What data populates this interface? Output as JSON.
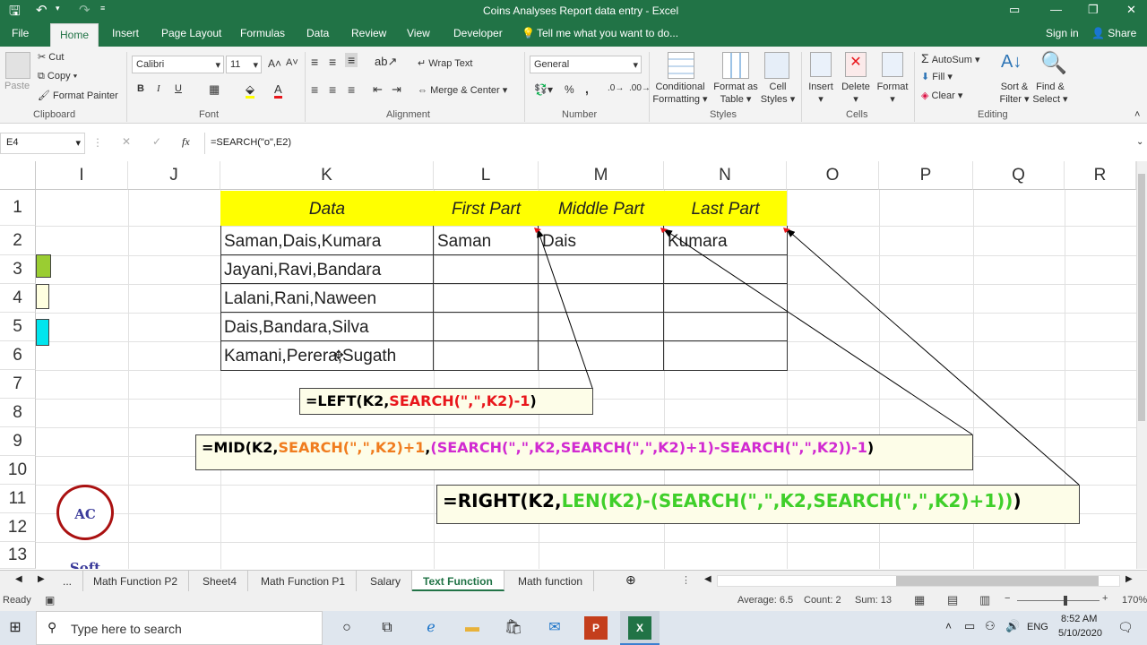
{
  "titlebar": {
    "title": "Coins Analyses Report data entry  -  Excel",
    "min": "—",
    "restore": "❐",
    "close": "✕",
    "opts": "▭"
  },
  "tabs": {
    "file": "File",
    "home": "Home",
    "insert": "Insert",
    "page_layout": "Page Layout",
    "formulas": "Formulas",
    "data": "Data",
    "review": "Review",
    "view": "View",
    "developer": "Developer",
    "tell": "Tell me what you want to do...",
    "signin": "Sign in",
    "share": "Share"
  },
  "ribbon": {
    "paste": "Paste",
    "cut": "Cut",
    "copy": "Copy",
    "format_painter": "Format Painter",
    "clipboard": "Clipboard",
    "font_name": "Calibri",
    "font_size": "11",
    "bold": "B",
    "italic": "I",
    "underline": "U",
    "font": "Font",
    "wrap_text": "Wrap Text",
    "merge_center": "Merge & Center",
    "alignment": "Alignment",
    "number_format": "General",
    "number": "Number",
    "percent": "%",
    "comma": ",",
    "conditional": "Conditional",
    "formatting": "Formatting",
    "format_as": "Format as",
    "table": "Table",
    "cell": "Cell",
    "cell_styles": "Styles",
    "styles": "Styles",
    "insert": "Insert",
    "delete": "Delete",
    "format": "Format",
    "cells": "Cells",
    "autosum": "AutoSum",
    "fill": "Fill",
    "clear": "Clear",
    "sort_filter": "Sort &",
    "filter": "Filter",
    "find_select": "Find &",
    "select": "Select",
    "editing": "Editing"
  },
  "formula_bar": {
    "name_box": "E4",
    "fx": "fx",
    "formula": "=SEARCH(\"o\",E2)"
  },
  "columns": [
    "I",
    "J",
    "K",
    "L",
    "M",
    "N",
    "O",
    "P",
    "Q",
    "R"
  ],
  "rows": [
    "1",
    "2",
    "3",
    "4",
    "5",
    "6",
    "7",
    "8",
    "9",
    "10",
    "11",
    "12",
    "13"
  ],
  "table": {
    "headers": [
      "Data",
      "First Part",
      "Middle Part",
      "Last Part"
    ],
    "data": [
      "Saman,Dais,Kumara",
      "Jayani,Ravi,Bandara",
      "Lalani,Rani,Naween",
      "Dais,Bandara,Silva",
      "Kamani,Perera,Sugath"
    ],
    "first": "Saman",
    "middle": "Dais",
    "last": "Kumara"
  },
  "formulas": {
    "left": {
      "a": "=LEFT(K2,",
      "b": "SEARCH(\",\",K2)-1",
      "c": ")"
    },
    "mid": {
      "a": "=MID(K2,",
      "b": "SEARCH(\",\",K2)+1",
      "c": ",",
      "d": "(SEARCH(\",\",K2,SEARCH(\",\",K2)+1)-SEARCH(\",\",K2))-1",
      "e": ")"
    },
    "right": {
      "a": "=RIGHT(K2,",
      "b": "LEN(K2)-(SEARCH(\",\",K2,SEARCH(\",\",K2)+1))",
      "c": ")"
    }
  },
  "logo": {
    "text": "AC Soft"
  },
  "sheets": [
    "...",
    "Math Function P2",
    "Sheet4",
    "Math Function P1",
    "Salary",
    "Text Function",
    "Math function"
  ],
  "status": {
    "ready": "Ready",
    "average": "Average: 6.5",
    "count": "Count: 2",
    "sum": "Sum: 13",
    "zoom": "170%"
  },
  "taskbar": {
    "search": "Type here to search",
    "lang": "ENG",
    "time": "8:52 AM",
    "date": "5/10/2020"
  },
  "colors": {
    "excel_green": "#217346",
    "header_yellow": "#ffff00",
    "formula_red": "#e8161b",
    "formula_orange": "#f07c1e",
    "formula_magenta": "#d12ad1",
    "formula_green": "#3fcf2a"
  }
}
